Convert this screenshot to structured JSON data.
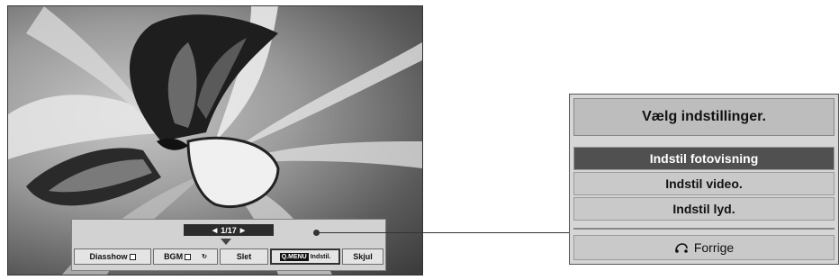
{
  "slideshow": {
    "counter": "1/17",
    "buttons": {
      "diasshow": "Diasshow",
      "bgm": "BGM",
      "slet": "Slet",
      "qmenu_tag": "Q.MENU",
      "qmenu_label": "Indstil.",
      "skjul": "Skjul"
    }
  },
  "menu": {
    "title": "Vælg indstillinger.",
    "items": [
      {
        "label": "Indstil fotovisning",
        "selected": true
      },
      {
        "label": "Indstil video.",
        "selected": false
      },
      {
        "label": "Indstil lyd.",
        "selected": false
      }
    ],
    "back_label": "Forrige"
  },
  "colors": {
    "selected_bg": "#505050",
    "menu_bg": "#d6d6d6"
  }
}
